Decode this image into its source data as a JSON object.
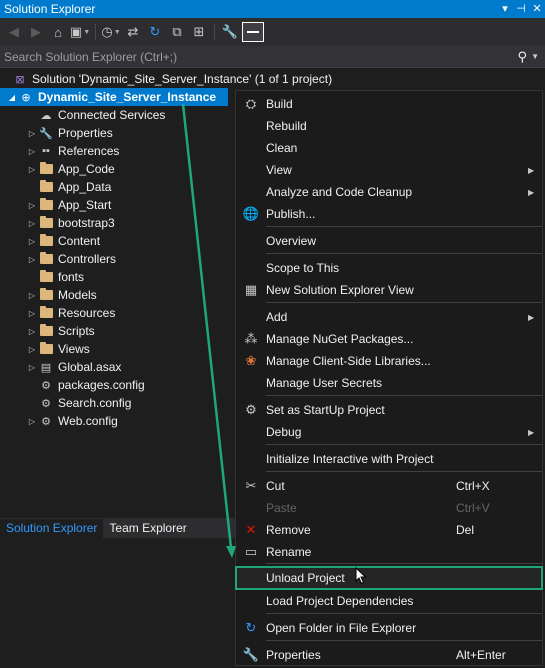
{
  "window": {
    "title": "Solution Explorer",
    "pin_icon": "dropdown-arrow",
    "close_icon": "close-x"
  },
  "search": {
    "placeholder": "Search Solution Explorer (Ctrl+;)"
  },
  "solution": {
    "label": "Solution 'Dynamic_Site_Server_Instance' (1 of 1 project)"
  },
  "project": {
    "label": "Dynamic_Site_Server_Instance"
  },
  "tree_items": [
    {
      "label": "Connected Services",
      "icon": "cloud-icon",
      "expandable": false
    },
    {
      "label": "Properties",
      "icon": "wrench-icon",
      "expandable": true
    },
    {
      "label": "References",
      "icon": "references-icon",
      "expandable": true
    },
    {
      "label": "App_Code",
      "icon": "folder-icon",
      "expandable": true
    },
    {
      "label": "App_Data",
      "icon": "folder-icon",
      "expandable": false
    },
    {
      "label": "App_Start",
      "icon": "folder-icon",
      "expandable": true
    },
    {
      "label": "bootstrap3",
      "icon": "folder-icon",
      "expandable": true
    },
    {
      "label": "Content",
      "icon": "folder-icon",
      "expandable": true
    },
    {
      "label": "Controllers",
      "icon": "folder-icon",
      "expandable": true
    },
    {
      "label": "fonts",
      "icon": "folder-icon",
      "expandable": false
    },
    {
      "label": "Models",
      "icon": "folder-icon",
      "expandable": true
    },
    {
      "label": "Resources",
      "icon": "folder-icon",
      "expandable": true
    },
    {
      "label": "Scripts",
      "icon": "folder-icon",
      "expandable": true
    },
    {
      "label": "Views",
      "icon": "folder-icon",
      "expandable": true
    },
    {
      "label": "Global.asax",
      "icon": "file-icon",
      "expandable": true
    },
    {
      "label": "packages.config",
      "icon": "config-file-icon",
      "expandable": false
    },
    {
      "label": "Search.config",
      "icon": "config-file-icon",
      "expandable": false
    },
    {
      "label": "Web.config",
      "icon": "config-file-icon",
      "expandable": true
    }
  ],
  "bottom_tabs": {
    "solution_explorer": "Solution Explorer",
    "team_explorer": "Team Explorer"
  },
  "context_menu": {
    "items": [
      {
        "label": "Build",
        "icon": "build-icon",
        "shortcut": "",
        "submenu": false
      },
      {
        "label": "Rebuild",
        "icon": "",
        "shortcut": "",
        "submenu": false
      },
      {
        "label": "Clean",
        "icon": "",
        "shortcut": "",
        "submenu": false
      },
      {
        "label": "View",
        "icon": "",
        "shortcut": "",
        "submenu": true
      },
      {
        "label": "Analyze and Code Cleanup",
        "icon": "",
        "shortcut": "",
        "submenu": true
      },
      {
        "label": "Publish...",
        "icon": "globe-icon",
        "shortcut": "",
        "submenu": false
      },
      {
        "label": "Overview",
        "icon": "",
        "shortcut": "",
        "submenu": false
      },
      {
        "label": "Scope to This",
        "icon": "",
        "shortcut": "",
        "submenu": false
      },
      {
        "label": "New Solution Explorer View",
        "icon": "new-view-icon",
        "shortcut": "",
        "submenu": false
      },
      {
        "label": "Add",
        "icon": "",
        "shortcut": "",
        "submenu": true
      },
      {
        "label": "Manage NuGet Packages...",
        "icon": "nuget-icon",
        "shortcut": "",
        "submenu": false
      },
      {
        "label": "Manage Client-Side Libraries...",
        "icon": "library-icon",
        "shortcut": "",
        "submenu": false
      },
      {
        "label": "Manage User Secrets",
        "icon": "",
        "shortcut": "",
        "submenu": false
      },
      {
        "label": "Set as StartUp Project",
        "icon": "gear-icon",
        "shortcut": "",
        "submenu": false
      },
      {
        "label": "Debug",
        "icon": "",
        "shortcut": "",
        "submenu": true
      },
      {
        "label": "Initialize Interactive with Project",
        "icon": "",
        "shortcut": "",
        "submenu": false
      },
      {
        "label": "Cut",
        "icon": "scissors-icon",
        "shortcut": "Ctrl+X",
        "submenu": false
      },
      {
        "label": "Paste",
        "icon": "",
        "shortcut": "Ctrl+V",
        "submenu": false,
        "disabled": true
      },
      {
        "label": "Remove",
        "icon": "remove-x-icon",
        "shortcut": "Del",
        "submenu": false
      },
      {
        "label": "Rename",
        "icon": "rename-icon",
        "shortcut": "",
        "submenu": false
      },
      {
        "label": "Unload Project",
        "icon": "",
        "shortcut": "",
        "submenu": false,
        "highlighted": true
      },
      {
        "label": "Load Project Dependencies",
        "icon": "",
        "shortcut": "",
        "submenu": false
      },
      {
        "label": "Open Folder in File Explorer",
        "icon": "refresh-arrow-icon",
        "shortcut": "",
        "submenu": false
      },
      {
        "label": "Properties",
        "icon": "wrench-icon",
        "shortcut": "Alt+Enter",
        "submenu": false
      }
    ]
  },
  "colors": {
    "accent": "#007acc",
    "highlight_outline": "#1fa67a",
    "annotation_arrow": "#1fa67a"
  }
}
